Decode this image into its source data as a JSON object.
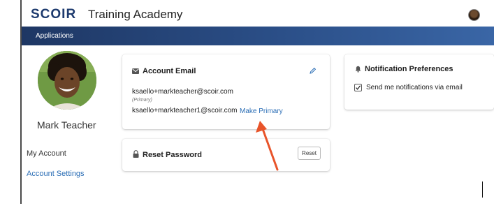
{
  "header": {
    "logo": "SCOIR",
    "app_title": "Training Academy"
  },
  "nav": {
    "items": [
      {
        "label": "Applications"
      }
    ]
  },
  "profile": {
    "name": "Mark Teacher",
    "avatar_icon": "user-photo"
  },
  "sidebar": {
    "items": [
      {
        "label": "My Account",
        "active": false
      },
      {
        "label": "Account Settings",
        "active": true
      }
    ]
  },
  "account_email": {
    "title": "Account Email",
    "icon": "envelope-icon",
    "edit_icon": "pencil-icon",
    "primary_email": "ksaello+markteacher@scoir.com",
    "primary_tag": "(Primary)",
    "secondary_email": "ksaello+markteacher1@scoir.com",
    "make_primary_label": "Make Primary"
  },
  "reset_password": {
    "title": "Reset Password",
    "icon": "lock-icon",
    "button_label": "Reset"
  },
  "notifications": {
    "title": "Notification Preferences",
    "icon": "bell-icon",
    "email_option_label": "Send me notifications via email",
    "email_option_checked": true
  },
  "colors": {
    "brand_navy": "#1d3a6e",
    "nav_blue": "#2b4f88",
    "link_blue": "#2a6db5",
    "annotation_arrow": "#e8542a"
  }
}
